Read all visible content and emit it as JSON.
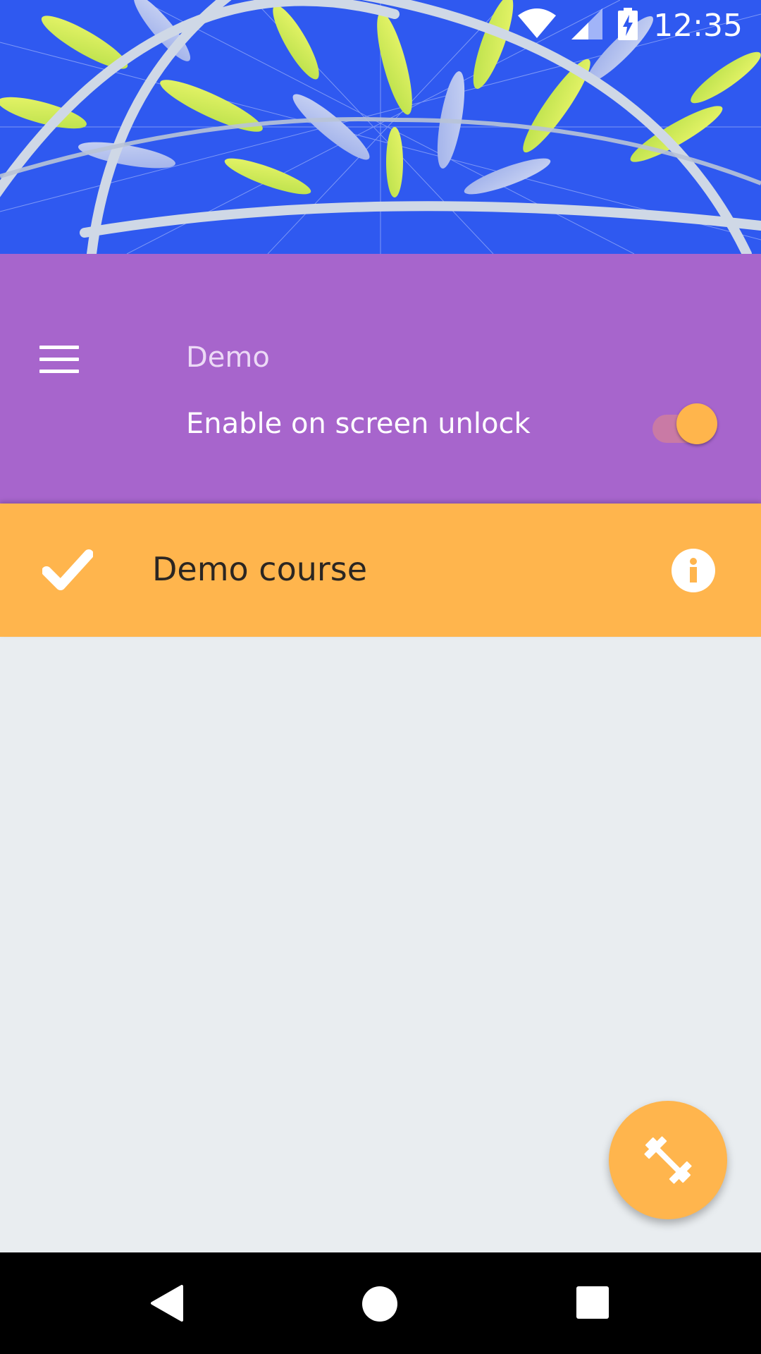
{
  "status_bar": {
    "time": "12:35",
    "icons": [
      "wifi-icon",
      "cell-signal-icon",
      "battery-charging-icon"
    ]
  },
  "header": {
    "title": "Demo",
    "toggle": {
      "label": "Enable on screen unlock",
      "on": true
    }
  },
  "courses": [
    {
      "name": "Demo course",
      "selected": true
    }
  ],
  "fab": {
    "icon": "dumbbell-icon"
  },
  "nav": {
    "icons": [
      "back-icon",
      "home-icon",
      "recents-icon"
    ]
  },
  "colors": {
    "header": "#a765cc",
    "accent": "#ffb54d",
    "background": "#e9edf0",
    "hero_sky": "#2f59f0"
  }
}
